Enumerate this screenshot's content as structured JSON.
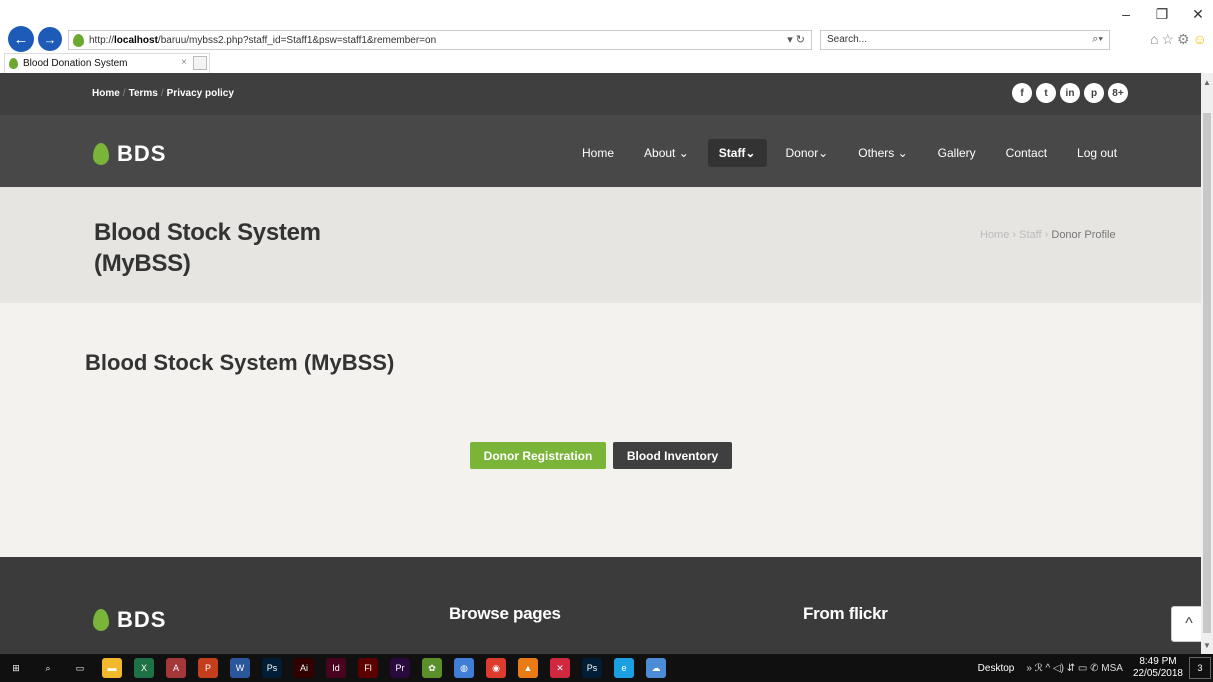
{
  "browser": {
    "url_prefix": "http://",
    "url_host": "localhost",
    "url_path": "/baruu/mybss2.php?staff_id=Staff1&psw=staff1&remember=on",
    "search_placeholder": "Search...",
    "tab_title": "Blood Donation System",
    "tab_close": "×",
    "refresh": "▾ ↻",
    "search_icon": "⌕▾",
    "right_icons": "⌂☆⚙",
    "smiley": "☺",
    "minimize": "–",
    "maximize": "❐",
    "close": "✕",
    "back": "←",
    "forward": "→"
  },
  "topstrip": {
    "home": "Home",
    "sep": "/",
    "terms": "Terms",
    "privacy": "Privacy policy",
    "social": [
      "f",
      "t",
      "in",
      "p",
      "8+"
    ]
  },
  "brand": {
    "name": "BDS",
    "color": "#7ab53a"
  },
  "menu": {
    "items": [
      "Home",
      "About ⌄",
      "Staff⌄",
      "Donor⌄",
      "Others ⌄",
      "Gallery",
      "Contact",
      "Log out"
    ],
    "active_index": 2
  },
  "banner": {
    "title_line1": "Blood Stock System",
    "title_line2": "(MyBSS)",
    "crumb_home": "Home",
    "crumb_staff": "Staff",
    "crumb_current": "Donor Profile",
    "crumb_sep": "›"
  },
  "main": {
    "heading": "Blood Stock System (MyBSS)",
    "btn_register": "Donor Registration",
    "btn_inventory": "Blood Inventory"
  },
  "footer": {
    "col1": "Browse pages",
    "col2": "From flickr",
    "scroll_top": "^"
  },
  "scrollbar": {
    "up": "▲",
    "down": "▼"
  },
  "taskbar": {
    "apps": [
      {
        "label": "⊞",
        "color": "#101010"
      },
      {
        "label": "⌕",
        "color": "#101010"
      },
      {
        "label": "▭",
        "color": "#101010"
      },
      {
        "label": "▬",
        "color": "#f2b82e"
      },
      {
        "label": "X",
        "color": "#1e7145"
      },
      {
        "label": "A",
        "color": "#a4373a"
      },
      {
        "label": "P",
        "color": "#c43e1c"
      },
      {
        "label": "W",
        "color": "#2b579a"
      },
      {
        "label": "Ps",
        "color": "#001e36"
      },
      {
        "label": "Ai",
        "color": "#330000"
      },
      {
        "label": "Id",
        "color": "#49021f"
      },
      {
        "label": "Fl",
        "color": "#5c0000"
      },
      {
        "label": "Pr",
        "color": "#2a0a3d"
      },
      {
        "label": "✿",
        "color": "#5a8f2a"
      },
      {
        "label": "◍",
        "color": "#3f7dd6"
      },
      {
        "label": "◉",
        "color": "#de3b2f"
      },
      {
        "label": "▲",
        "color": "#e97b16"
      },
      {
        "label": "✕",
        "color": "#d1273f"
      },
      {
        "label": "Ps",
        "color": "#001e36"
      },
      {
        "label": "e",
        "color": "#1ba1e2"
      },
      {
        "label": "☁",
        "color": "#4c8bd6"
      }
    ],
    "desktop": "Desktop",
    "tray": "» ℛ ^ ◁) ⇵ ▭ ✆ MSA",
    "time": "8:49 PM",
    "date": "22/05/2018",
    "notif": "3"
  }
}
